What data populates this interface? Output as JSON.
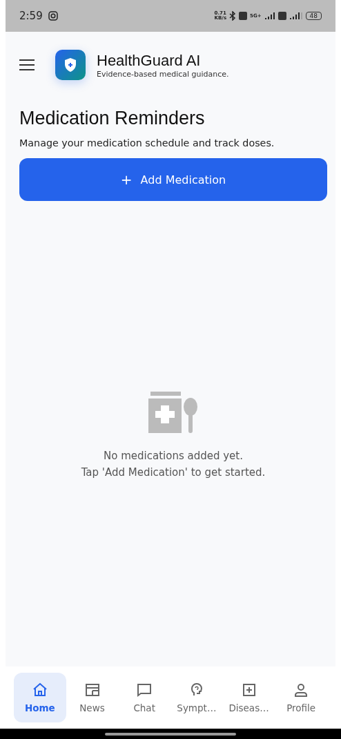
{
  "status_bar": {
    "time": "2:59",
    "net_speed": "0.71",
    "net_unit": "KB/s",
    "network": "5G+",
    "battery": "48"
  },
  "header": {
    "title": "HealthGuard AI",
    "subtitle": "Evidence-based medical guidance."
  },
  "page": {
    "title": "Medication Reminders",
    "description": "Manage your medication schedule and track doses.",
    "add_button": {
      "icon": "+",
      "label": "Add Medication"
    }
  },
  "empty_state": {
    "lines": [
      "No medications added yet.",
      "Tap 'Add Medication' to get started."
    ]
  },
  "bottom_nav": [
    {
      "kind": "home",
      "label": "Home",
      "selected": true
    },
    {
      "kind": "news",
      "label": "News",
      "selected": false
    },
    {
      "kind": "chat",
      "label": "Chat",
      "selected": false
    },
    {
      "kind": "symptom",
      "label": "Sympt…",
      "selected": false
    },
    {
      "kind": "disease",
      "label": "Diseas…",
      "selected": false
    },
    {
      "kind": "profile",
      "label": "Profile",
      "selected": false
    }
  ]
}
